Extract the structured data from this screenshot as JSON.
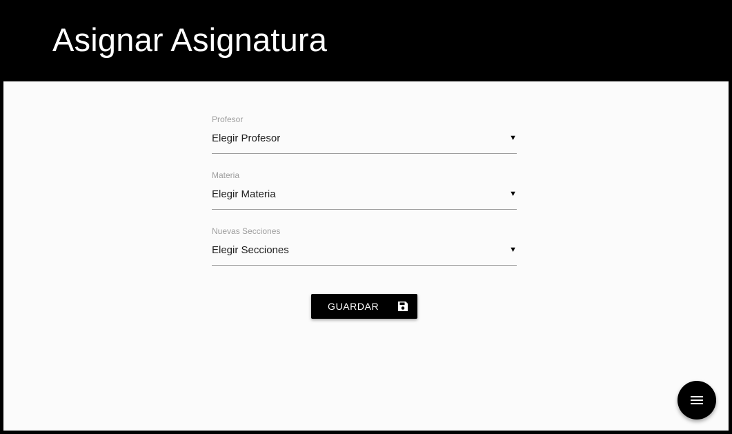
{
  "header": {
    "title": "Asignar Asignatura"
  },
  "form": {
    "fields": [
      {
        "label": "Profesor",
        "value": "Elegir Profesor"
      },
      {
        "label": "Materia",
        "value": "Elegir Materia"
      },
      {
        "label": "Nuevas Secciones",
        "value": "Elegir Secciones"
      }
    ],
    "caret_glyph": "▼",
    "save_label": "GUARDAR",
    "save_icon": "floppy-disk-icon"
  },
  "fab": {
    "icon": "menu-icon"
  },
  "colors": {
    "header_bg": "#000000",
    "content_bg": "#fbfbfb",
    "button_bg": "#000000",
    "label_text": "#9e9e9e",
    "value_text": "#212121"
  }
}
